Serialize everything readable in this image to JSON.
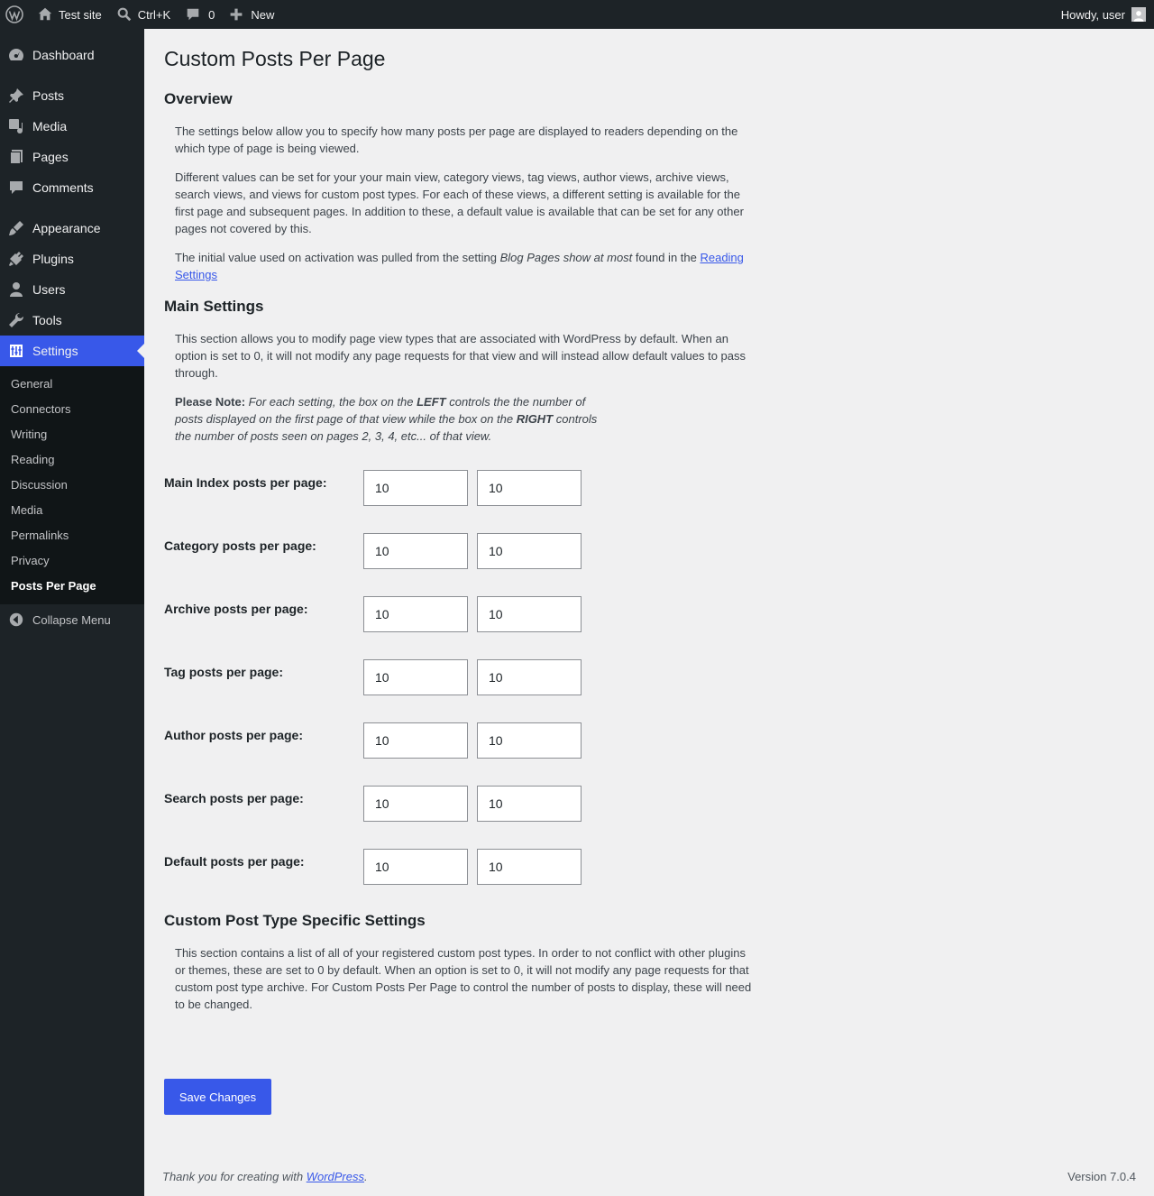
{
  "adminbar": {
    "site_name": "Test site",
    "search_shortcut": "Ctrl+K",
    "comments_count": "0",
    "new_label": "New",
    "howdy": "Howdy, user"
  },
  "sidebar": {
    "items": [
      {
        "label": "Dashboard"
      },
      {
        "label": "Posts"
      },
      {
        "label": "Media"
      },
      {
        "label": "Pages"
      },
      {
        "label": "Comments"
      },
      {
        "label": "Appearance"
      },
      {
        "label": "Plugins"
      },
      {
        "label": "Users"
      },
      {
        "label": "Tools"
      },
      {
        "label": "Settings"
      }
    ],
    "submenu": [
      {
        "label": "General"
      },
      {
        "label": "Connectors"
      },
      {
        "label": "Writing"
      },
      {
        "label": "Reading"
      },
      {
        "label": "Discussion"
      },
      {
        "label": "Media"
      },
      {
        "label": "Permalinks"
      },
      {
        "label": "Privacy"
      },
      {
        "label": "Posts Per Page"
      }
    ],
    "collapse_label": "Collapse Menu"
  },
  "page": {
    "title": "Custom Posts Per Page",
    "overview": {
      "heading": "Overview",
      "p1": "The settings below allow you to specify how many posts per page are displayed to readers depending on the which type of page is being viewed.",
      "p2": "Different values can be set for your your main view, category views, tag views, author views, archive views, search views, and views for custom post types. For each of these views, a different setting is available for the first page and subsequent pages. In addition to these, a default value is available that can be set for any other pages not covered by this.",
      "p3_before": "The initial value used on activation was pulled from the setting ",
      "p3_em": "Blog Pages show at most",
      "p3_middle": " found in the ",
      "p3_link": "Reading Settings"
    },
    "main_settings": {
      "heading": "Main Settings",
      "p1": "This section allows you to modify page view types that are associated with WordPress by default. When an option is set to 0, it will not modify any page requests for that view and will instead allow default values to pass through.",
      "note_label": "Please Note:",
      "note_1": " For each setting, the box on the ",
      "note_left": "LEFT",
      "note_2": " controls the the number of posts displayed on the first page of that view while the box on the ",
      "note_right": "RIGHT",
      "note_3": " controls the number of posts seen on pages 2, 3, 4, etc... of that view."
    },
    "rows": [
      {
        "label": "Main Index posts per page:",
        "first": "10",
        "subsequent": "10"
      },
      {
        "label": "Category posts per page:",
        "first": "10",
        "subsequent": "10"
      },
      {
        "label": "Archive posts per page:",
        "first": "10",
        "subsequent": "10"
      },
      {
        "label": "Tag posts per page:",
        "first": "10",
        "subsequent": "10"
      },
      {
        "label": "Author posts per page:",
        "first": "10",
        "subsequent": "10"
      },
      {
        "label": "Search posts per page:",
        "first": "10",
        "subsequent": "10"
      },
      {
        "label": "Default posts per page:",
        "first": "10",
        "subsequent": "10"
      }
    ],
    "custom_post_types": {
      "heading": "Custom Post Type Specific Settings",
      "p1": "This section contains a list of all of your registered custom post types. In order to not conflict with other plugins or themes, these are set to 0 by default. When an option is set to 0, it will not modify any page requests for that custom post type archive. For Custom Posts Per Page to control the number of posts to display, these will need to be changed."
    },
    "save_label": "Save Changes"
  },
  "footer": {
    "thanks_before": "Thank you for creating with ",
    "thanks_link": "WordPress",
    "thanks_after": ".",
    "version": "Version 7.0.4"
  },
  "colors": {
    "admin_bg": "#1d2327",
    "accent": "#3858e9",
    "page_bg": "#f0f0f1"
  }
}
